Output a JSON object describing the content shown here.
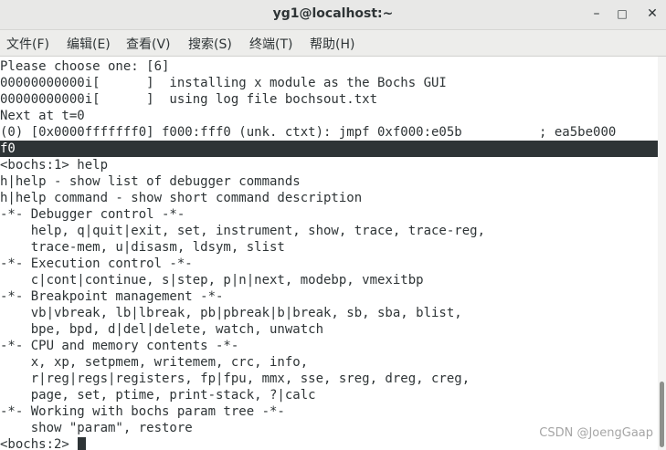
{
  "window": {
    "title": "yg1@localhost:~",
    "minimize_glyph": "–",
    "maximize_glyph": "□",
    "close_glyph": "✕"
  },
  "menu": {
    "items": [
      {
        "label": "文件(F)"
      },
      {
        "label": "编辑(E)"
      },
      {
        "label": "查看(V)"
      },
      {
        "label": "搜索(S)"
      },
      {
        "label": "终端(T)"
      },
      {
        "label": "帮助(H)"
      }
    ]
  },
  "terminal": {
    "lines": [
      "Please choose one: [6]",
      "00000000000i[      ]  installing x module as the Bochs GUI",
      "00000000000i[      ]  using log file bochsout.txt",
      "Next at t=0",
      "(0) [0x0000fffffff0] f000:fff0 (unk. ctxt): jmpf 0xf000:e05b          ; ea5be000",
      "f0",
      "<bochs:1> help",
      "h|help - show list of debugger commands",
      "h|help command - show short command description",
      "-*- Debugger control -*-",
      "    help, q|quit|exit, set, instrument, show, trace, trace-reg,",
      "    trace-mem, u|disasm, ldsym, slist",
      "-*- Execution control -*-",
      "    c|cont|continue, s|step, p|n|next, modebp, vmexitbp",
      "-*- Breakpoint management -*-",
      "    vb|vbreak, lb|lbreak, pb|pbreak|b|break, sb, sba, blist,",
      "    bpe, bpd, d|del|delete, watch, unwatch",
      "-*- CPU and memory contents -*-",
      "    x, xp, setpmem, writemem, crc, info,",
      "    r|reg|regs|registers, fp|fpu, mmx, sse, sreg, dreg, creg,",
      "    page, set, ptime, print-stack, ?|calc",
      "-*- Working with bochs param tree -*-",
      "    show \"param\", restore"
    ],
    "prompt": "<bochs:2> "
  },
  "watermark": "CSDN @JoengGaap",
  "colors": {
    "foreground": "#2e3436",
    "background": "#ffffff",
    "highlight_bg": "#2e3436",
    "highlight_fg": "#ffffff"
  }
}
